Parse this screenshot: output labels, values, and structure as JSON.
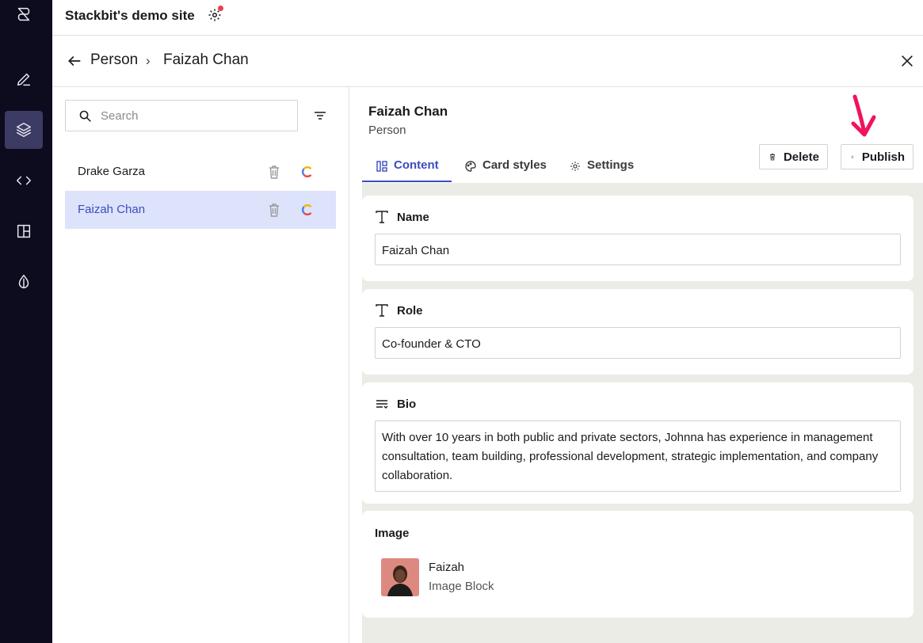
{
  "app": {
    "site_title": "Stackbit's demo site",
    "accent_color": "#3b4cc0",
    "notification_color": "#ef3b4f"
  },
  "rail": {
    "items": [
      {
        "icon": "stackbit-logo-icon"
      },
      {
        "icon": "pencil-icon"
      },
      {
        "icon": "layers-icon",
        "active": true
      },
      {
        "icon": "code-icon"
      },
      {
        "icon": "layout-icon"
      },
      {
        "icon": "theme-drop-icon"
      }
    ]
  },
  "header": {
    "breadcrumb_parent": "Person",
    "breadcrumb_separator": "›",
    "breadcrumb_current": "Faizah Chan"
  },
  "list": {
    "search_placeholder": "Search",
    "items": [
      {
        "label": "Drake Garza",
        "selected": false
      },
      {
        "label": "Faizah Chan",
        "selected": true
      }
    ]
  },
  "editor": {
    "title": "Faizah Chan",
    "type": "Person",
    "delete_label": "Delete",
    "publish_label": "Publish",
    "tabs": [
      {
        "label": "Content",
        "active": true
      },
      {
        "label": "Card styles",
        "active": false
      },
      {
        "label": "Settings",
        "active": false
      }
    ],
    "fields": {
      "name": {
        "label": "Name",
        "value": "Faizah Chan"
      },
      "role": {
        "label": "Role",
        "value": "Co-founder & CTO"
      },
      "bio": {
        "label": "Bio",
        "value": "With over 10 years in both public and private sectors, Johnna has experience in management consultation, team building, professional development, strategic implementation, and company collaboration."
      },
      "image": {
        "label": "Image",
        "name": "Faizah",
        "type": "Image Block"
      }
    }
  }
}
